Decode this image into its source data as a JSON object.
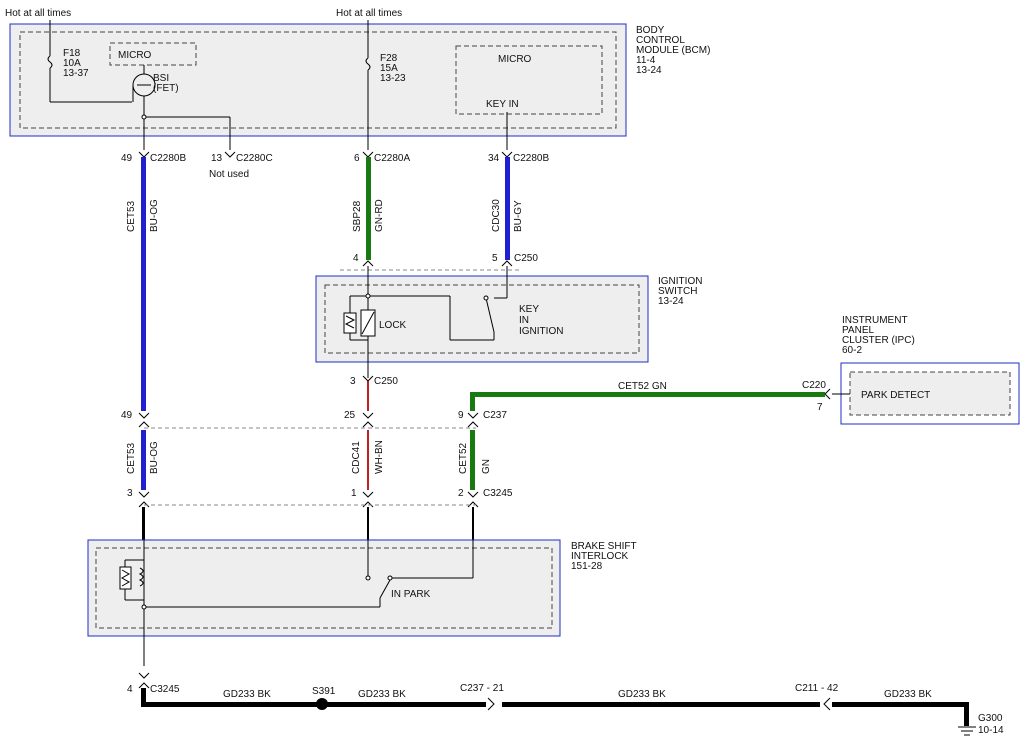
{
  "colors": {
    "module_border": "#1f2cc4",
    "module_fill": "#eeeeee",
    "wire_blue": "#2020d0",
    "wire_green": "#1a7a12",
    "wire_red": "#c02020",
    "wire_black": "#000000"
  },
  "top": {
    "hot1": "Hot at all times",
    "hot2": "Hot at all times"
  },
  "bcm": {
    "title": [
      "BODY",
      "CONTROL",
      "MODULE (BCM)",
      "11-4",
      "13-24"
    ],
    "fuse1": [
      "F18",
      "10A",
      "13-37"
    ],
    "micro1": "MICRO",
    "bsi": [
      "BSI",
      "(FET)"
    ],
    "fuse2": [
      "F28",
      "15A",
      "13-23"
    ],
    "micro2": "MICRO",
    "key_in": "KEY IN"
  },
  "connectors_top": {
    "c1_pin": "49",
    "c1_name": "C2280B",
    "c2_pin": "13",
    "c2_name": "C2280C",
    "c2_note": "Not used",
    "c3_pin": "6",
    "c3_name": "C2280A",
    "c4_pin": "34",
    "c4_name": "C2280B"
  },
  "wires_upper": {
    "w1_circuit": "CET53",
    "w1_color": "BU-OG",
    "w2_circuit": "SBP28",
    "w2_color": "GN-RD",
    "w3_circuit": "CDC30",
    "w3_color": "BU-GY"
  },
  "ignition": {
    "pin4": "4",
    "pin5": "5",
    "connector": "C250",
    "title": [
      "IGNITION",
      "SWITCH",
      "13-24"
    ],
    "lock": "LOCK",
    "key": [
      "KEY",
      "IN",
      "IGNITION"
    ],
    "pin3": "3",
    "connector_bottom": "C250"
  },
  "ipc": {
    "title": [
      "INSTRUMENT",
      "PANEL",
      "CLUSTER (IPC)",
      "60-2"
    ],
    "park_detect": "PARK DETECT",
    "connector": "C220",
    "pin": "7",
    "wire": "CET52  GN"
  },
  "c237": {
    "pin_left": "49",
    "pin_mid": "25",
    "pin_right": "9",
    "name": "C237"
  },
  "wires_lower": {
    "w1_circuit": "CET53",
    "w1_color": "BU-OG",
    "w2_circuit": "CDC41",
    "w2_color": "WH-BN",
    "w3_circuit": "CET52",
    "w3_color": "GN"
  },
  "c3245": {
    "pin_left": "3",
    "pin_mid": "1",
    "pin_right": "2",
    "name": "C3245"
  },
  "bsi_module": {
    "title": [
      "BRAKE SHIFT",
      "INTERLOCK",
      "151-28"
    ],
    "in_park": "IN PARK"
  },
  "ground": {
    "pin": "4",
    "connector": "C3245",
    "seg1": "GD233   BK",
    "splice": "S391",
    "seg2": "GD233   BK",
    "inline1": "C237 - 21",
    "seg3": "GD233   BK",
    "inline2": "C211 - 42",
    "seg4": "GD233   BK",
    "g_name": "G300",
    "g_ref": "10-14"
  }
}
